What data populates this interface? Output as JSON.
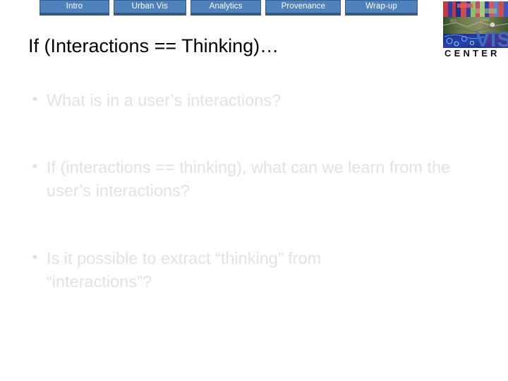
{
  "slide": {
    "background_color": "#ffffff",
    "title": "If (Interactions == Thinking)…",
    "title_color": "#000000",
    "body_text_color": "#e2e2e2"
  },
  "navigation": {
    "accent_color": "#4f81bd",
    "border_color": "#385d8a",
    "underline_color": "#3a5a7d",
    "label_color": "#ffffff",
    "tabs": [
      {
        "label": "Intro",
        "name": "tab-intro"
      },
      {
        "label": "Urban Vis",
        "name": "tab-urban-vis"
      },
      {
        "label": "Analytics",
        "name": "tab-analytics"
      },
      {
        "label": "Provenance",
        "name": "tab-provenance"
      },
      {
        "label": "Wrap-up",
        "name": "tab-wrap-up"
      }
    ]
  },
  "logo": {
    "name": "vis-center-logo",
    "wordmark_top": "VIS",
    "wordmark_bottom": "CENTER",
    "wordmark_top_color": "#3f6fb5",
    "wordmark_bottom_color": "#111111"
  },
  "content": {
    "bullet_marker": "•",
    "bullets": [
      "What is in a user’s interactions?",
      "If (interactions == thinking), what can we learn from the user’s interactions?",
      "Is it possible to extract “thinking” from “interactions”?"
    ]
  }
}
